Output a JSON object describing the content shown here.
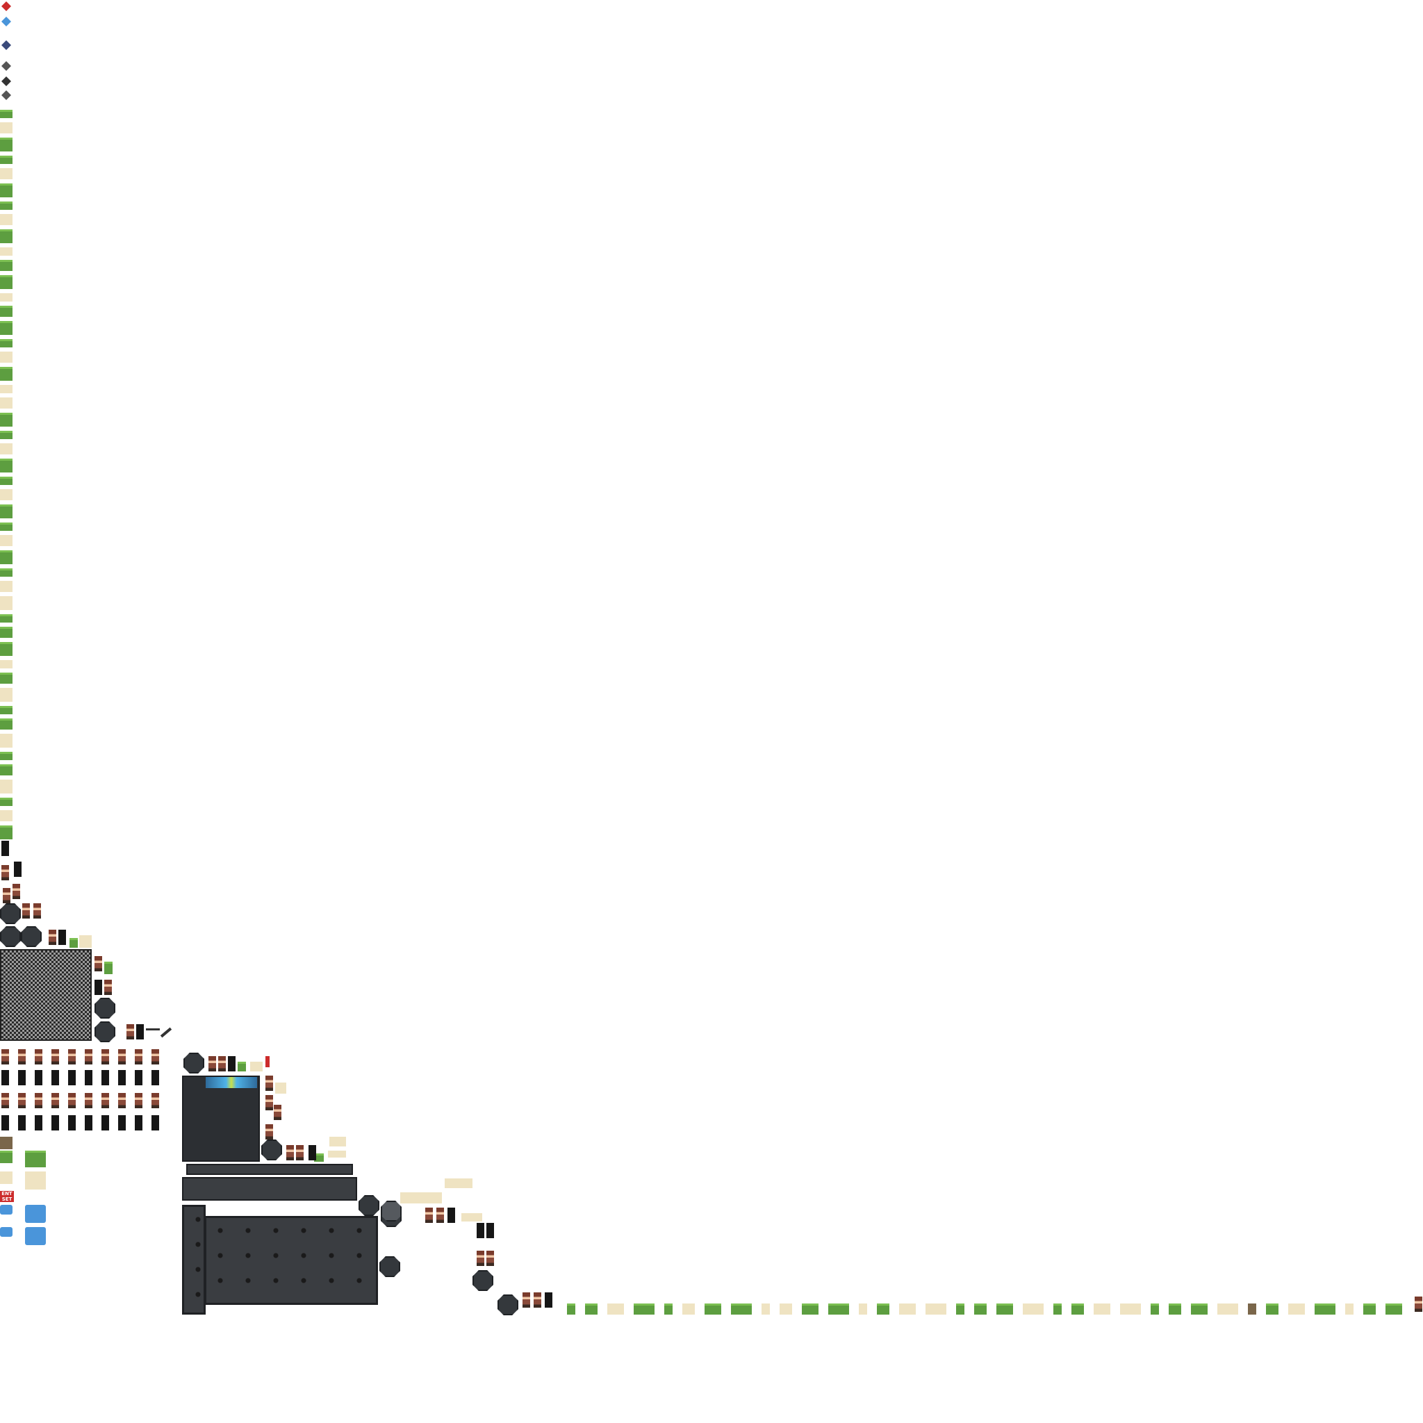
{
  "sheet": {
    "label": "ENT SET"
  },
  "icons": [
    "heart-icon",
    "sword-icon",
    "pickaxe-icon",
    "grass-tuft-icon",
    "key-icon"
  ],
  "colors": {
    "grass": "#5d9e40",
    "sand": "#efe3c2",
    "dirt": "#7a664a",
    "water": "#4a95da",
    "stone": "#2c2f33",
    "accent_red": "#cc2b2b"
  }
}
